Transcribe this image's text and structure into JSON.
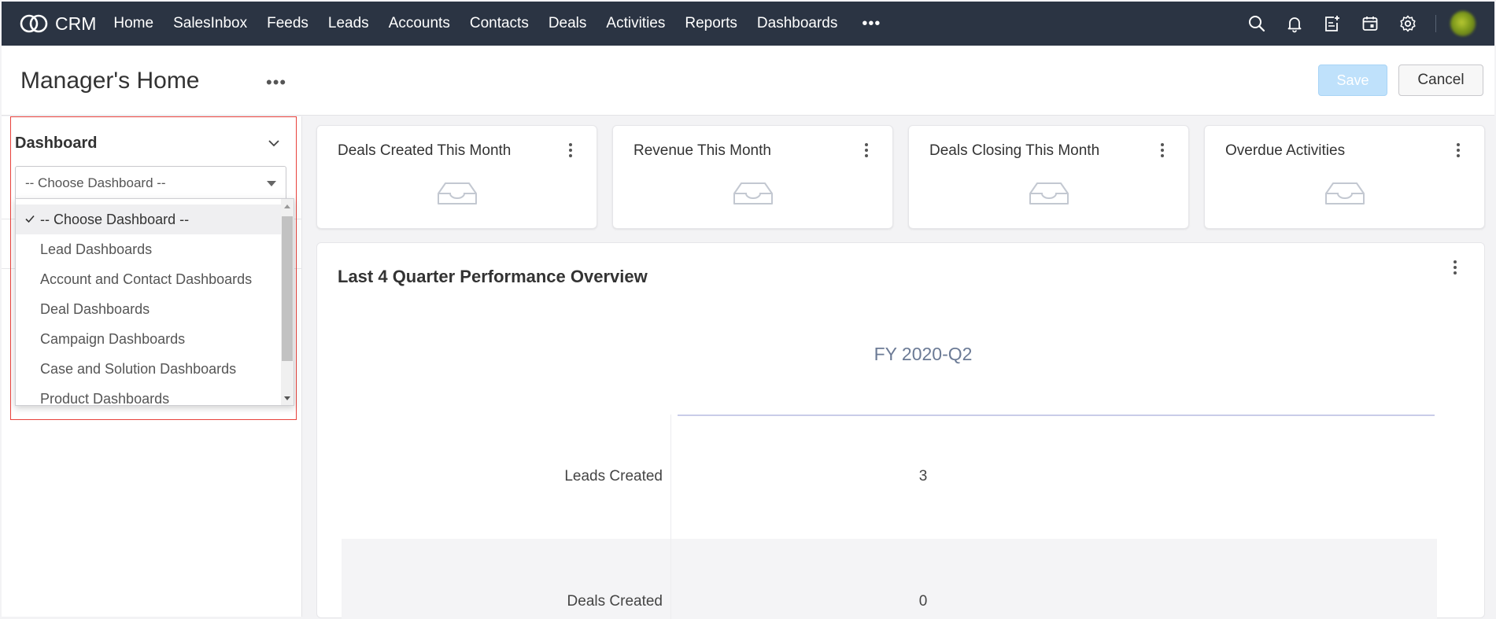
{
  "nav": {
    "logo_text": "CRM",
    "links": [
      "Home",
      "SalesInbox",
      "Feeds",
      "Leads",
      "Accounts",
      "Contacts",
      "Deals",
      "Activities",
      "Reports",
      "Dashboards"
    ],
    "more": "•••",
    "icons": [
      "search-icon",
      "bell-icon",
      "add-note-icon",
      "calendar-icon",
      "gear-icon"
    ],
    "bg_color": "#2b3443"
  },
  "header": {
    "title": "Manager's Home",
    "more": "•••",
    "save_label": "Save",
    "cancel_label": "Cancel"
  },
  "left_panel": {
    "section_label": "Dashboard",
    "select_value": "-- Choose Dashboard --",
    "dropdown_options": [
      "-- Choose Dashboard --",
      "Lead Dashboards",
      "Account and Contact Dashboards",
      "Deal Dashboards",
      "Campaign Dashboards",
      "Case and Solution Dashboards",
      "Product Dashboards"
    ],
    "selected_index": 0,
    "highlight_color": "#e8413b"
  },
  "cards": [
    {
      "title": "Deals Created This Month"
    },
    {
      "title": "Revenue This Month"
    },
    {
      "title": "Deals Closing This Month"
    },
    {
      "title": "Overdue Activities"
    }
  ],
  "performance": {
    "title": "Last 4 Quarter Performance Overview",
    "quarter": "FY 2020-Q2",
    "rows": [
      {
        "label": "Leads Created",
        "value": "3"
      },
      {
        "label": "Deals Created",
        "value": "0"
      }
    ]
  }
}
